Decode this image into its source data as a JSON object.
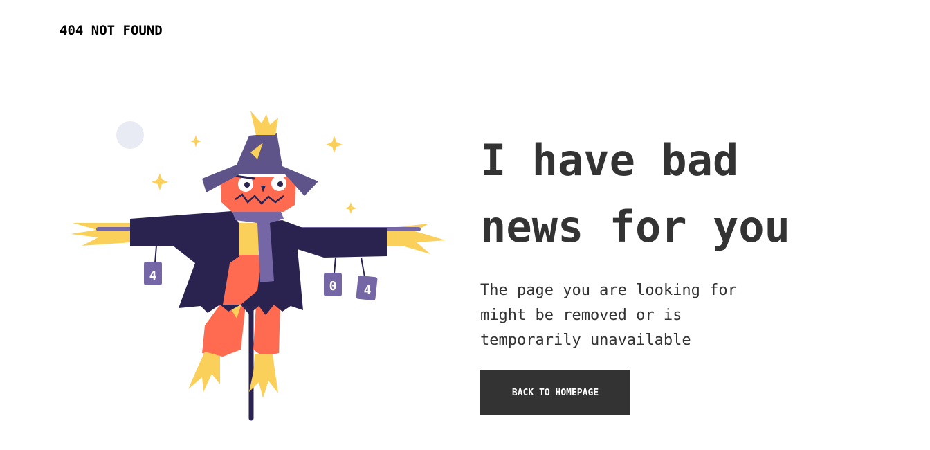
{
  "brand": {
    "title": "404 NOT FOUND"
  },
  "hero": {
    "headline": "I have bad\nnews for you",
    "description": "The page you are looking for might be removed or is temporarily unavailable",
    "button_label": "BACK TO HOMEPAGE"
  },
  "illustration": {
    "cans": [
      "4",
      "0",
      "4"
    ]
  },
  "colors": {
    "text": "#333333",
    "button_bg": "#333333",
    "button_text": "#ffffff",
    "hat": "#5E5489",
    "coat": "#2A2350",
    "face": "#FF6B50",
    "straw": "#FBD05A",
    "scarf": "#7567A5",
    "moon": "#E8EAF4"
  }
}
